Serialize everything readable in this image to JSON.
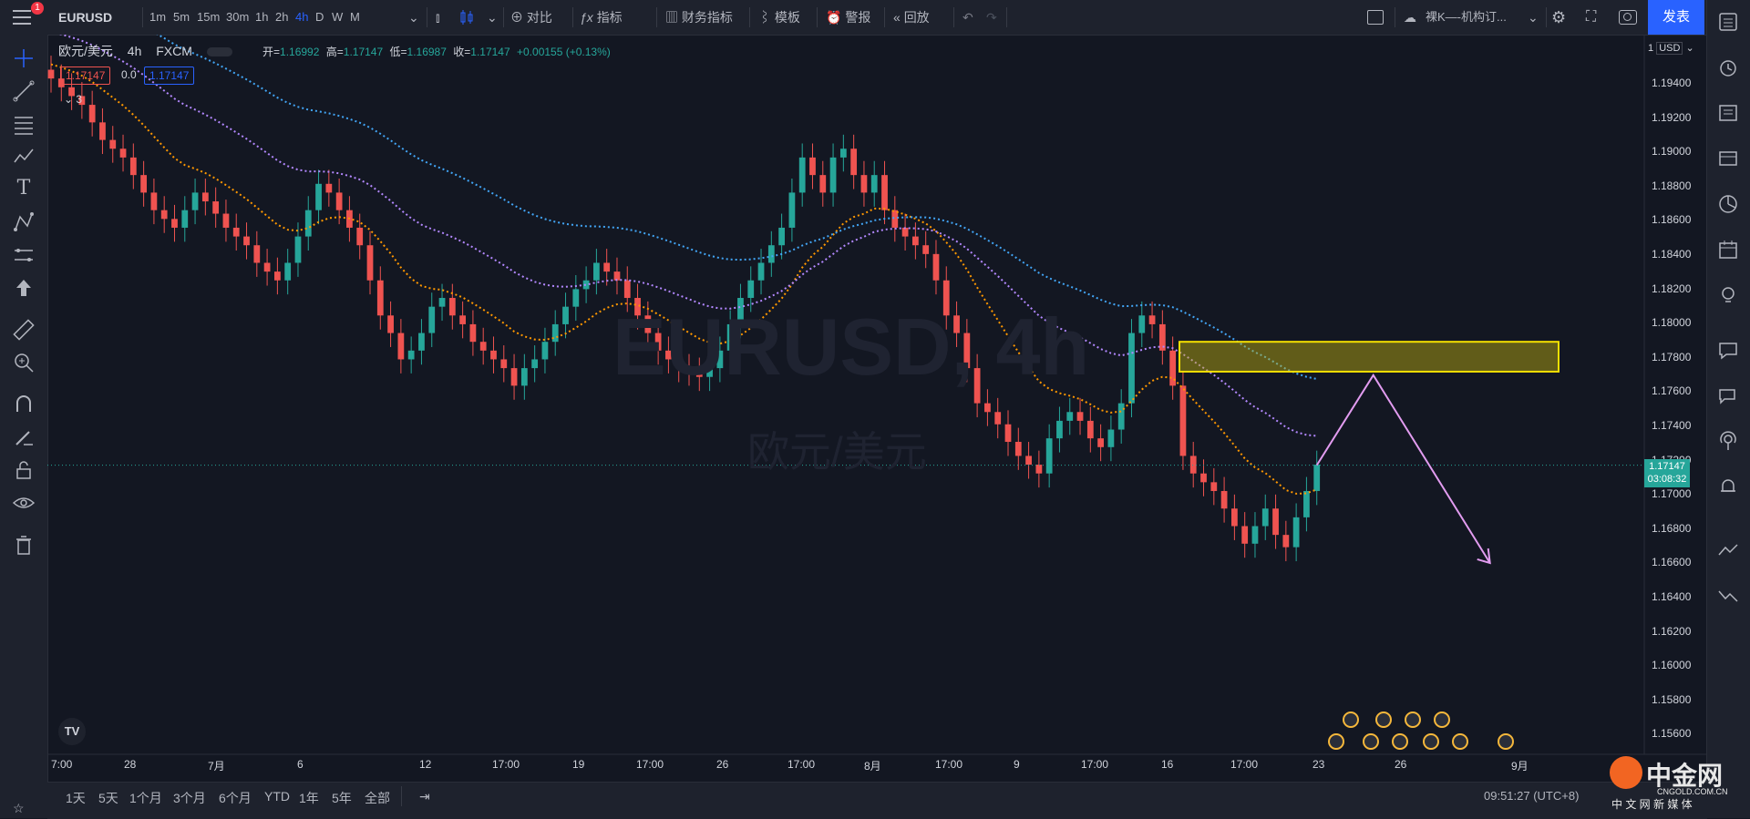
{
  "topbar": {
    "notification_count": "1",
    "symbol": "EURUSD",
    "intervals": [
      "1m",
      "5m",
      "15m",
      "30m",
      "1h",
      "2h",
      "4h",
      "D",
      "W",
      "M"
    ],
    "active_interval": "4h",
    "compare_label": "对比",
    "indicators_label": "指标",
    "financials_label": "财务指标",
    "templates_label": "模板",
    "alert_label": "警报",
    "replay_label": "回放",
    "layout_name": "裸K—-机构订...",
    "publish_label": "发表"
  },
  "legend": {
    "title": "欧元/美元",
    "interval": "4h",
    "source": "FXCM",
    "open_label": "开=",
    "open": "1.16992",
    "high_label": "高=",
    "high": "1.17147",
    "low_label": "低=",
    "low": "1.16987",
    "close_label": "收=",
    "close": "1.17147",
    "change": "+0.00155 (+0.13%)",
    "sell_price": "1.17147",
    "spread": "0.0",
    "buy_price": "1.17147",
    "collapse_count": "3"
  },
  "watermark": {
    "symbol": "EURUSD, 4h",
    "name": "欧元/美元"
  },
  "price_axis": {
    "currency": "USD",
    "scale_label": "1",
    "ticks": [
      "1.19400",
      "1.19200",
      "1.19000",
      "1.18800",
      "1.18600",
      "1.18400",
      "1.18200",
      "1.18000",
      "1.17800",
      "1.17600",
      "1.17400",
      "1.17200",
      "1.17000",
      "1.16800",
      "1.16600",
      "1.16400",
      "1.16200",
      "1.16000",
      "1.15800",
      "1.15600"
    ],
    "last_price": "1.17147",
    "countdown": "03:08:32"
  },
  "time_axis": {
    "labels": [
      "7:00",
      "28",
      "7月",
      "6",
      "12",
      "17:00",
      "19",
      "17:00",
      "26",
      "17:00",
      "8月",
      "17:00",
      "9",
      "17:00",
      "16",
      "17:00",
      "23",
      "26",
      "9月"
    ]
  },
  "bottombar": {
    "ranges": [
      "1天",
      "5天",
      "1个月",
      "3个月",
      "6个月",
      "YTD",
      "1年",
      "5年",
      "全部"
    ],
    "clock": "09:51:27 (UTC+8)",
    "watermark_brand": "中金网",
    "watermark_site": "CNGOLD.COM.CN",
    "watermark_tagline": "中 文 网 新 媒 体"
  },
  "colors": {
    "up": "#26a69a",
    "down": "#ef5350",
    "ema_fast": "#ff9800",
    "ema_mid": "#b388ff",
    "ema_slow": "#42a5f5",
    "zone": "#c2b210",
    "projection": "#e29cf0"
  },
  "chart_data": {
    "type": "candlestick",
    "symbol": "EURUSD",
    "interval": "4h",
    "ylim": [
      1.155,
      1.196
    ],
    "last_price": 1.17147,
    "candles_close": [
      1.1935,
      1.193,
      1.1925,
      1.192,
      1.191,
      1.19,
      1.1895,
      1.189,
      1.188,
      1.187,
      1.186,
      1.1855,
      1.185,
      1.186,
      1.187,
      1.1865,
      1.1858,
      1.185,
      1.1845,
      1.184,
      1.183,
      1.1825,
      1.182,
      1.183,
      1.1845,
      1.186,
      1.1875,
      1.187,
      1.186,
      1.185,
      1.184,
      1.182,
      1.18,
      1.179,
      1.1775,
      1.178,
      1.179,
      1.1805,
      1.181,
      1.18,
      1.1795,
      1.1785,
      1.178,
      1.1775,
      1.177,
      1.176,
      1.177,
      1.1775,
      1.1785,
      1.1795,
      1.1805,
      1.1815,
      1.182,
      1.183,
      1.1825,
      1.182,
      1.181,
      1.18,
      1.179,
      1.178,
      1.1775,
      1.177,
      1.1768,
      1.1765,
      1.177,
      1.178,
      1.1795,
      1.181,
      1.182,
      1.183,
      1.184,
      1.185,
      1.187,
      1.189,
      1.188,
      1.187,
      1.189,
      1.1895,
      1.188,
      1.187,
      1.188,
      1.186,
      1.185,
      1.1845,
      1.184,
      1.1835,
      1.182,
      1.18,
      1.179,
      1.177,
      1.175,
      1.1745,
      1.1738,
      1.1728,
      1.172,
      1.1715,
      1.171,
      1.173,
      1.174,
      1.1745,
      1.174,
      1.173,
      1.1725,
      1.1735,
      1.175,
      1.179,
      1.18,
      1.1795,
      1.178,
      1.176,
      1.172,
      1.171,
      1.1705,
      1.17,
      1.169,
      1.168,
      1.167,
      1.168,
      1.169,
      1.1675,
      1.1668,
      1.1685,
      1.17,
      1.1715
    ]
  }
}
